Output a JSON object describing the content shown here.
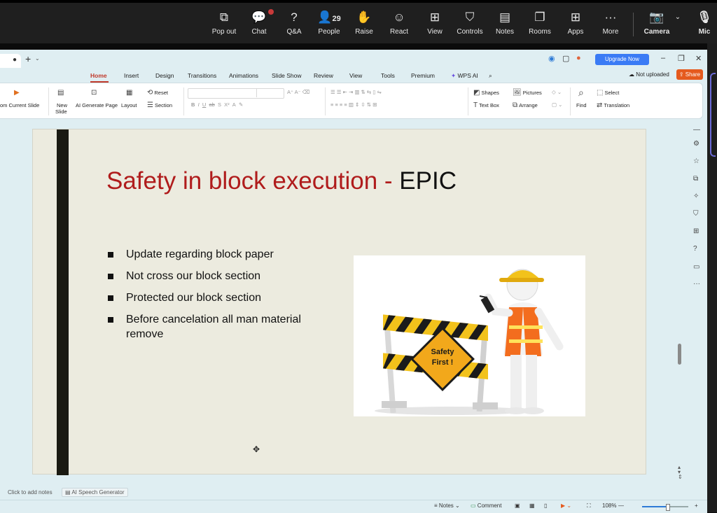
{
  "meeting_toolbar": {
    "buttons": [
      {
        "label": "Pop out",
        "icon": "pop-out-icon"
      },
      {
        "label": "Chat",
        "icon": "chat-icon"
      },
      {
        "label": "Q&A",
        "icon": "qa-icon"
      },
      {
        "label": "People",
        "icon": "people-icon",
        "count": "29"
      },
      {
        "label": "Raise",
        "icon": "raise-hand-icon"
      },
      {
        "label": "React",
        "icon": "react-icon"
      },
      {
        "label": "View",
        "icon": "view-icon"
      },
      {
        "label": "Controls",
        "icon": "controls-icon"
      },
      {
        "label": "Notes",
        "icon": "notes-icon"
      },
      {
        "label": "Rooms",
        "icon": "rooms-icon"
      },
      {
        "label": "Apps",
        "icon": "apps-icon"
      },
      {
        "label": "More",
        "icon": "more-icon"
      },
      {
        "label": "Camera",
        "icon": "camera-off-icon"
      },
      {
        "label": "Mic",
        "icon": "mic-off-icon"
      }
    ]
  },
  "titlebar": {
    "upgrade": "Upgrade Now"
  },
  "menu": {
    "tabs": [
      "Home",
      "Insert",
      "Design",
      "Transitions",
      "Animations",
      "Slide Show",
      "Review",
      "View",
      "Tools",
      "Premium",
      "WPS AI"
    ],
    "active": "Home",
    "status": "Not uploaded",
    "share": "Share"
  },
  "ribbon": {
    "from_current": "om Current Slide",
    "new_slide": "New",
    "new_slide2": "Slide",
    "ai_generate": "AI Generate Page",
    "layout": "Layout",
    "reset": "Reset",
    "section": "Section",
    "shapes": "Shapes",
    "pictures": "Pictures",
    "text_box": "Text Box",
    "arrange": "Arrange",
    "find": "Find",
    "select": "Select",
    "translation": "Translation"
  },
  "slide": {
    "title_red": "Safety in block execution - ",
    "title_black": "EPIC",
    "bullets": [
      "Update regarding block paper",
      "Not cross our block section",
      "Protected our block section",
      "Before cancelation all man material remove"
    ],
    "sign_text_1": "Safety",
    "sign_text_2": "First !"
  },
  "notes": {
    "placeholder": "Click to add notes",
    "ai_speech": "AI Speech Generator"
  },
  "statusbar": {
    "notes": "Notes",
    "comment": "Comment",
    "zoom": "108%"
  }
}
